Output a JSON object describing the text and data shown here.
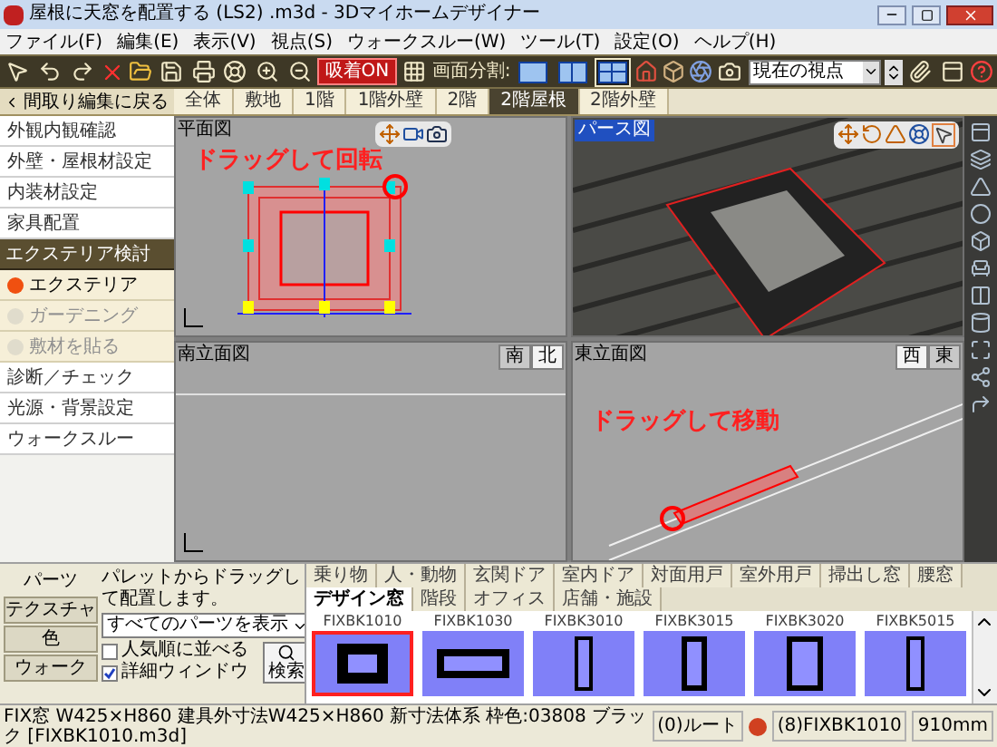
{
  "window": {
    "title": "屋根に天窓を配置する (LS2) .m3d - 3Dマイホームデザイナー"
  },
  "menu": [
    "ファイル(F)",
    "編集(E)",
    "表示(V)",
    "視点(S)",
    "ウォークスルー(W)",
    "ツール(T)",
    "設定(O)",
    "ヘルプ(H)"
  ],
  "toolbar": {
    "snap": {
      "label": "吸着ON",
      "on": true
    },
    "split_label": "画面分割:",
    "split_options": [
      {
        "kind": "single",
        "selected": false
      },
      {
        "kind": "double",
        "selected": false
      },
      {
        "kind": "quad",
        "selected": true
      }
    ],
    "viewpoint": {
      "value": "現在の視点"
    }
  },
  "back_button": "間取り編集に戻る",
  "floor_tabs": [
    {
      "label": "全体",
      "selected": false
    },
    {
      "label": "敷地",
      "selected": false
    },
    {
      "label": "1階",
      "selected": false
    },
    {
      "label": "1階外壁",
      "selected": false
    },
    {
      "label": "2階",
      "selected": false
    },
    {
      "label": "2階屋根",
      "selected": true
    },
    {
      "label": "2階外壁",
      "selected": false
    }
  ],
  "sidebar": [
    {
      "kind": "item",
      "label": "外観内観確認"
    },
    {
      "kind": "item",
      "label": "外壁・屋根材設定"
    },
    {
      "kind": "item",
      "label": "内装材設定"
    },
    {
      "kind": "item",
      "label": "家具配置"
    },
    {
      "kind": "header",
      "label": "エクステリア検討"
    },
    {
      "kind": "sub",
      "label": "エクステリア",
      "selected": true
    },
    {
      "kind": "sub",
      "label": "ガーデニング",
      "selected": false
    },
    {
      "kind": "sub",
      "label": "敷材を貼る",
      "selected": false
    },
    {
      "kind": "item",
      "label": "診断／チェック"
    },
    {
      "kind": "item",
      "label": "光源・背景設定"
    },
    {
      "kind": "item",
      "label": "ウォークスルー"
    }
  ],
  "views": [
    {
      "kind": "plan",
      "title": "平面図",
      "hint": "ドラッグして回転"
    },
    {
      "kind": "perspective",
      "title": "パース図"
    },
    {
      "kind": "elevation",
      "title": "南立面図",
      "directions": [
        {
          "label": "南",
          "selected": true
        },
        {
          "label": "北",
          "selected": false
        }
      ]
    },
    {
      "kind": "slope",
      "title": "東立面図",
      "hint": "ドラッグして移動",
      "directions": [
        {
          "label": "西",
          "selected": false
        },
        {
          "label": "東",
          "selected": true
        }
      ]
    }
  ],
  "parts": {
    "side_tabs": [
      {
        "label": "パーツ",
        "selected": true
      },
      {
        "label": "テクスチャ",
        "selected": false
      },
      {
        "label": "色",
        "selected": false
      },
      {
        "label": "ウォーク",
        "selected": false
      }
    ],
    "message": "パレットからドラッグして配置します。",
    "filter": {
      "value": "すべてのパーツを表示"
    },
    "options": [
      {
        "label": "人気順に並べる",
        "checked": false
      },
      {
        "label": "詳細ウィンドウ",
        "checked": true
      }
    ],
    "search_button": "検索",
    "categories": [
      {
        "label": "乗り物",
        "selected": false
      },
      {
        "label": "人・動物",
        "selected": false
      },
      {
        "label": "玄関ドア",
        "selected": false
      },
      {
        "label": "室内ドア",
        "selected": false
      },
      {
        "label": "対面用戸",
        "selected": false
      },
      {
        "label": "室外用戸",
        "selected": false
      },
      {
        "label": "掃出し窓",
        "selected": false
      },
      {
        "label": "腰窓",
        "selected": false
      },
      {
        "label": "デザイン窓",
        "selected": true
      },
      {
        "label": "階段",
        "selected": false
      },
      {
        "label": "オフィス",
        "selected": false
      },
      {
        "label": "店舗・施設",
        "selected": false
      }
    ],
    "items": [
      {
        "label": "FIXBK1010",
        "kind": "square",
        "selected": true
      },
      {
        "label": "FIXBK1030",
        "kind": "wide",
        "selected": false
      },
      {
        "label": "FIXBK3010",
        "kind": "narrow",
        "selected": false
      },
      {
        "label": "FIXBK3015",
        "kind": "tall",
        "selected": false
      },
      {
        "label": "FIXBK3020",
        "kind": "broad",
        "selected": false
      },
      {
        "label": "FIXBK5015",
        "kind": "narrow",
        "selected": false
      }
    ]
  },
  "status_bar": {
    "info": "FIX窓 W425×H860 建具外寸法W425×H860 新寸法体系 枠色:03808 ブラック [FIXBK1010.m3d]",
    "layer": "(0)ルート",
    "part": "(8)FIXBK1010",
    "length": "910mm"
  }
}
